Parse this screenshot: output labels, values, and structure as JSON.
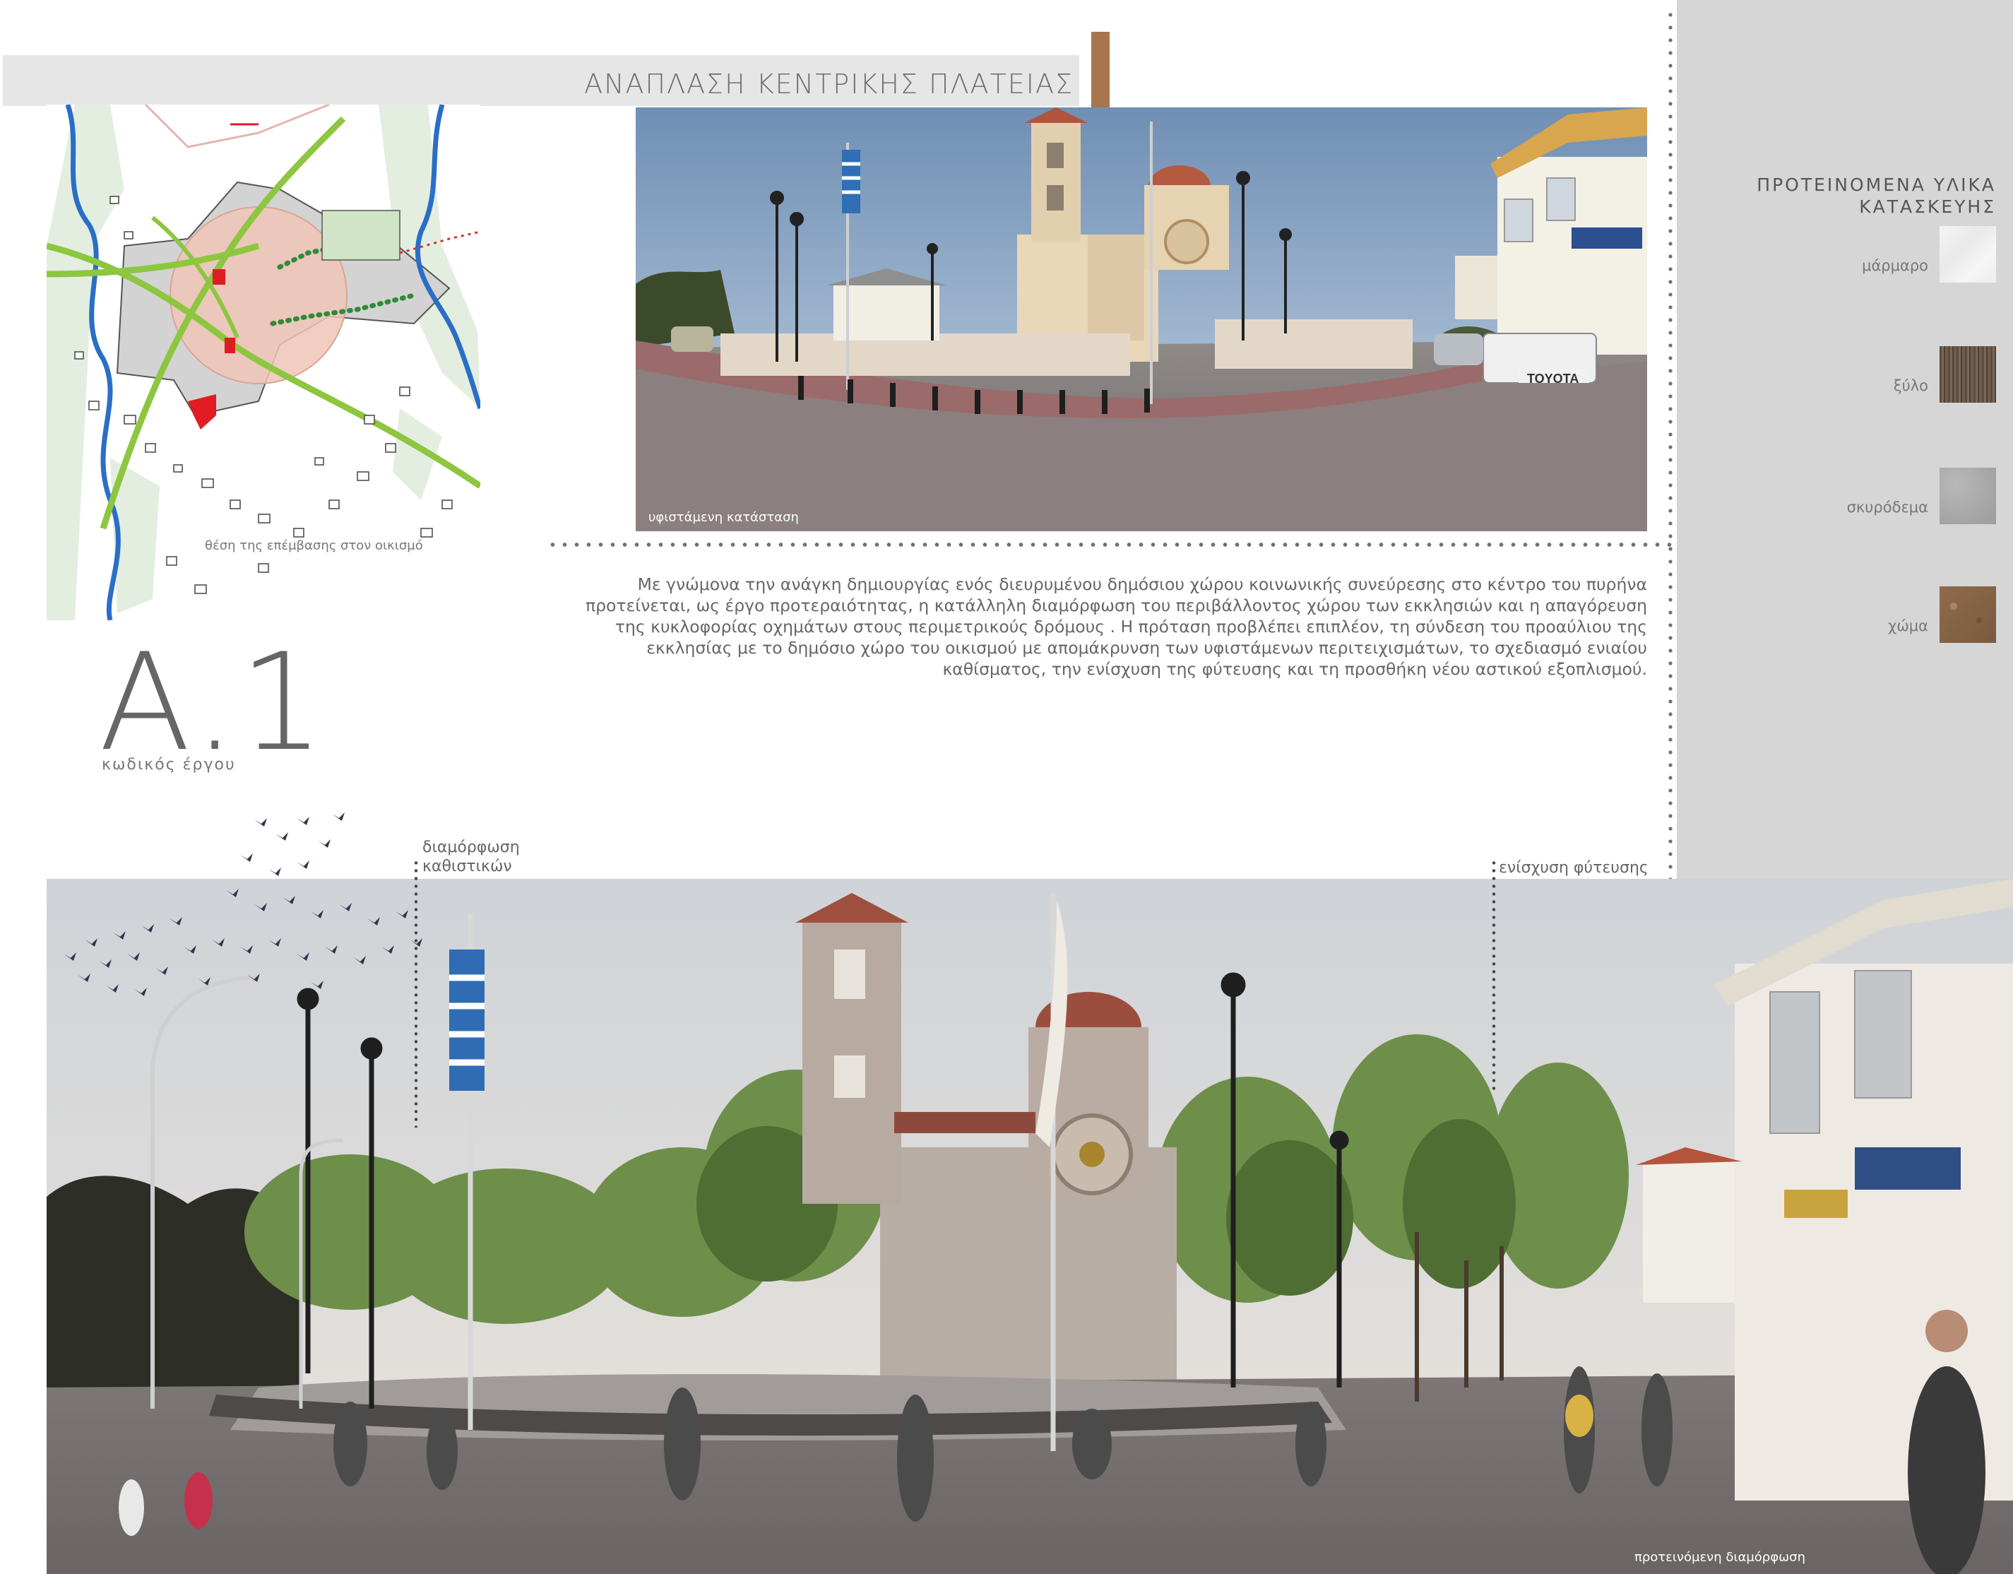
{
  "header": {
    "title": "ΑΝΑΠΛΑΣΗ ΚΕΝΤΡΙΚΗΣ ΠΛΑΤΕΙΑΣ",
    "accent_color": "#a7764f"
  },
  "map": {
    "caption": "θέση της επέμβασης στον οικισμό"
  },
  "project": {
    "code": "Α.1",
    "code_label": "κωδικός έργου"
  },
  "existing_photo": {
    "label": "υφιστάμενη κατάσταση",
    "sign_text": "TOYOTA"
  },
  "description": {
    "text": "Με γνώμονα την ανάγκη δημιουργίας ενός διευρυμένου δημόσιου χώρου κοινωνικής συνεύρεσης στο κέντρο του πυρήνα προτείνεται, ως έργο προτεραιότητας, η κατάλληλη διαμόρφωση του περιβάλλοντος χώρου των εκκλησιών και η απαγόρευση της κυκλοφορίας οχημάτων στους περιμετρικούς δρόμους . Η πρόταση προβλέπει επιπλέον, τη σύνδεση του προαύλιου της εκκλησίας με το δημόσιο χώρο του οικισμού με απομάκρυνση των υφιστάμενων περιτειχισμάτων, το σχεδιασμό ενιαίου καθίσματος, την ενίσχυση της φύτευσης και τη προσθήκη νέου αστικού εξοπλισμού."
  },
  "materials": {
    "title_line1": "ΠΡΟΤΕΙΝΟΜΕΝΑ ΥΛΙΚΑ",
    "title_line2": "ΚΑΤΑΣΚΕΥΗΣ",
    "items": [
      {
        "label": "μάρμαρο",
        "color": "#efefef"
      },
      {
        "label": "ξύλο",
        "color": "#6a5848"
      },
      {
        "label": "σκυρόδεμα",
        "color": "#a8a8a8"
      },
      {
        "label": "χώμα",
        "color": "#836245"
      }
    ]
  },
  "annotations": {
    "seating_line1": "διαμόρφωση",
    "seating_line2": "καθιστικών",
    "planting": "ενίσχυση φύτευσης"
  },
  "proposed_photo": {
    "label": "προτεινόμενη διαμόρφωση"
  }
}
